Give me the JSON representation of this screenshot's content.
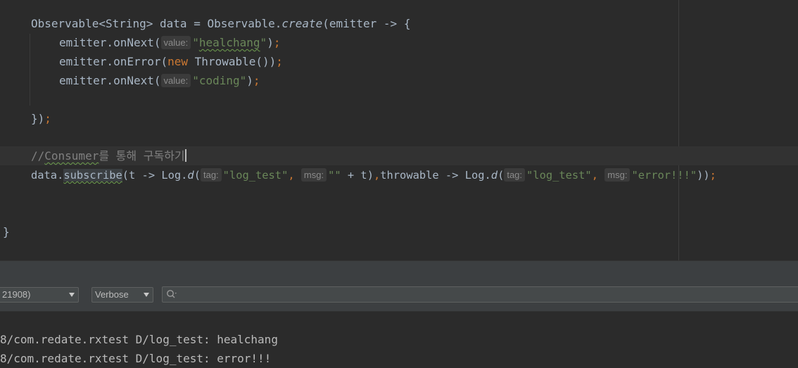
{
  "editor": {
    "lines": {
      "l1": {
        "a": "Observable<String> data = Observable.",
        "b": "create",
        "c": "(emitter -> {"
      },
      "l2": {
        "a": "emitter.onNext(",
        "hint": "value:",
        "str_q1": "\"",
        "str_word": "healchang",
        "str_q2": "\"",
        "close": ")",
        "semi": ";"
      },
      "l3": {
        "a": "emitter.onError(",
        "kw": "new",
        "b": " Throwable())",
        "semi": ";"
      },
      "l4": {
        "a": "emitter.onNext(",
        "hint": "value:",
        "str": "\"coding\"",
        "close": ")",
        "semi": ";"
      },
      "l6": {
        "a": "})",
        "semi": ";"
      },
      "l8": {
        "slashes": "//",
        "word": "Consumer",
        "rest": "를 통해 구독하기"
      },
      "l9": {
        "a": "data.",
        "method": "subscribe",
        "b": "(t -> Log.",
        "d1": "d",
        "c": "(",
        "hint_tag1": "tag:",
        "str_tag1": "\"log_test\"",
        "comma1": ",",
        "hint_msg1": "msg:",
        "str_msg1": "\"\"",
        "d": " + t)",
        "comma2": ",",
        "e": "throwable -> Log.",
        "d2": "d",
        "f": "(",
        "hint_tag2": "tag:",
        "str_tag2": "\"log_test\"",
        "comma3": ",",
        "hint_msg2": "msg:",
        "str_msg2": "\"error!!!\"",
        "g": "))",
        "semi": ";"
      },
      "l12": {
        "a": "}"
      }
    }
  },
  "logcat": {
    "process_combo": "21908)",
    "level_combo": "Verbose",
    "search_placeholder": "",
    "lines": [
      "8/com.redate.rxtest D/log_test: healchang",
      "8/com.redate.rxtest D/log_test: error!!!"
    ]
  },
  "colors": {
    "background": "#2b2b2b",
    "keyword": "#cc7832",
    "string": "#6a8759",
    "comment": "#808080",
    "text": "#a9b7c6"
  }
}
